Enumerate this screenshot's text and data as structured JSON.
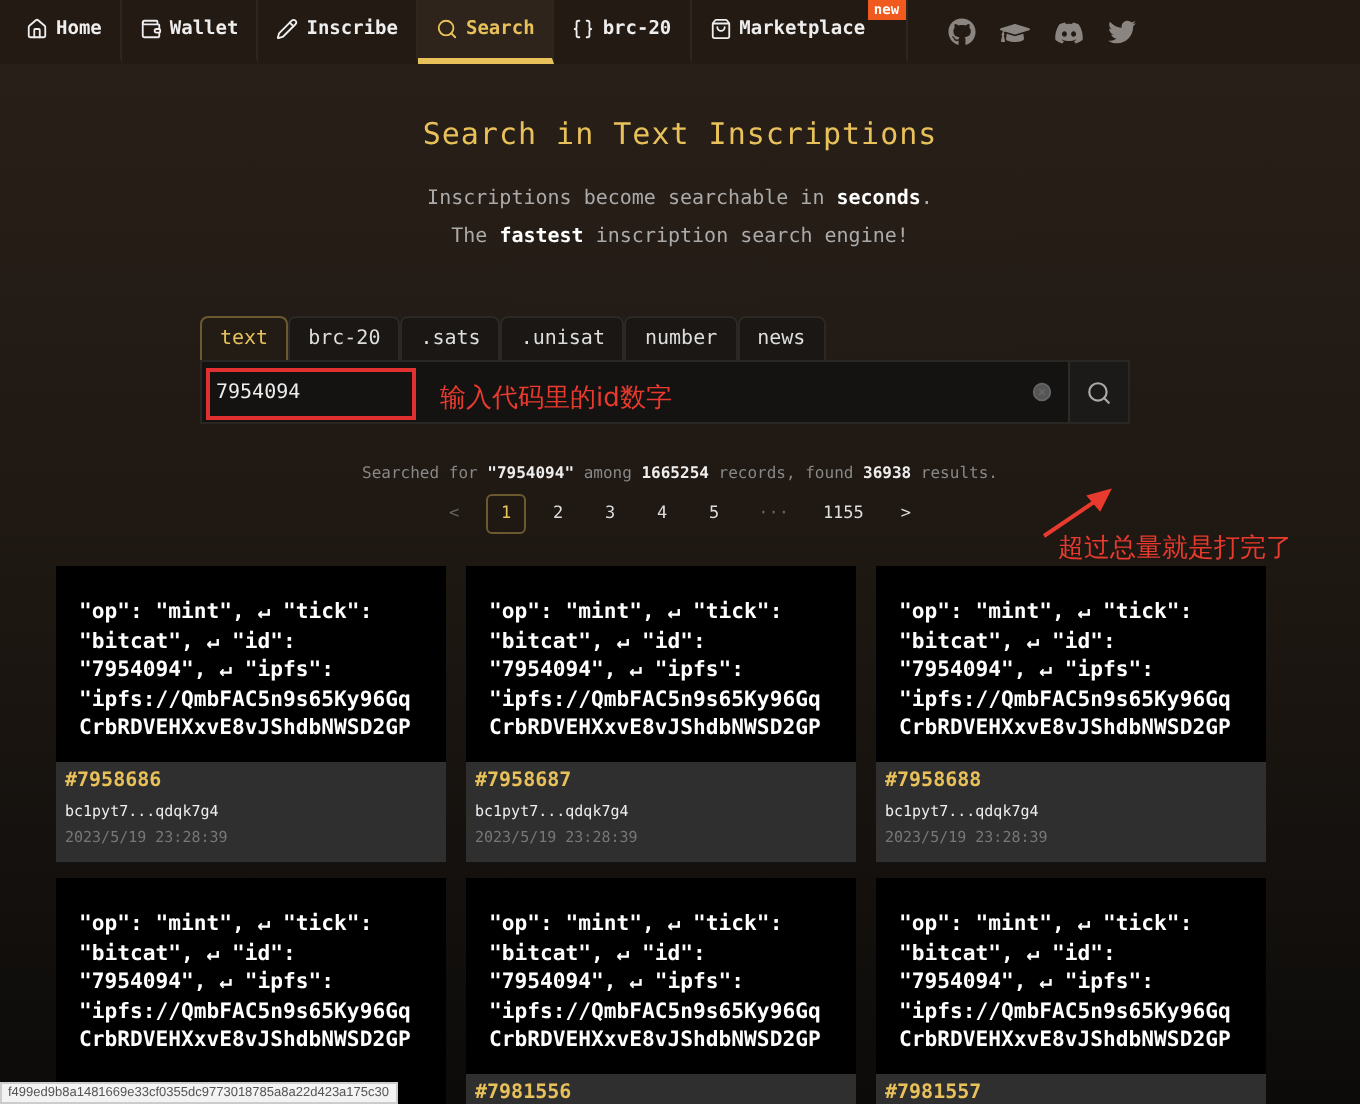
{
  "nav": {
    "items": [
      {
        "label": "Home",
        "selected": false
      },
      {
        "label": "Wallet",
        "selected": false
      },
      {
        "label": "Inscribe",
        "selected": false
      },
      {
        "label": "Search",
        "selected": true
      },
      {
        "label": "brc-20",
        "selected": false
      },
      {
        "label": "Marketplace",
        "selected": false,
        "badge": "new"
      }
    ]
  },
  "hero": {
    "title": "Search in Text Inscriptions",
    "lines": [
      "Inscriptions become searchable in **seconds**.",
      "The **fastest** inscription search engine!"
    ]
  },
  "search_tabs": [
    {
      "label": "text",
      "selected": true
    },
    {
      "label": "brc-20",
      "selected": false
    },
    {
      "label": ".sats",
      "selected": false
    },
    {
      "label": ".unisat",
      "selected": false
    },
    {
      "label": "number",
      "selected": false
    },
    {
      "label": "news",
      "selected": false
    }
  ],
  "search": {
    "value": "7954094"
  },
  "annotations": {
    "input_note": "输入代码里的id数字",
    "total_note": "超过总量就是打完了"
  },
  "summary": "Searched for **\"7954094\"** among **1665254** records, found **36938** results.",
  "pagination": [
    {
      "kind": "prev",
      "label": "<"
    },
    {
      "kind": "page",
      "label": "1",
      "selected": true
    },
    {
      "kind": "page",
      "label": "2",
      "selected": false
    },
    {
      "kind": "page",
      "label": "3",
      "selected": false
    },
    {
      "kind": "page",
      "label": "4",
      "selected": false
    },
    {
      "kind": "page",
      "label": "5",
      "selected": false
    },
    {
      "kind": "ellipsis",
      "label": "···"
    },
    {
      "kind": "page",
      "label": "1155",
      "selected": false
    },
    {
      "kind": "next",
      "label": ">"
    }
  ],
  "cards": [
    {
      "content": "\"op\": \"mint\", ↵ \"tick\": \"bitcat\", ↵ \"id\": \"7954094\", ↵ \"ipfs\": \"ipfs://QmbFAC5n9s65Ky96GqCrbRDVEHXxvE8vJShdbNWSD2GP",
      "number": "#7958686",
      "address": "bc1pyt7...qdqk7g4",
      "time": "2023/5/19 23:28:39"
    },
    {
      "content": "\"op\": \"mint\", ↵ \"tick\": \"bitcat\", ↵ \"id\": \"7954094\", ↵ \"ipfs\": \"ipfs://QmbFAC5n9s65Ky96GqCrbRDVEHXxvE8vJShdbNWSD2GP",
      "number": "#7958687",
      "address": "bc1pyt7...qdqk7g4",
      "time": "2023/5/19 23:28:39"
    },
    {
      "content": "\"op\": \"mint\", ↵ \"tick\": \"bitcat\", ↵ \"id\": \"7954094\", ↵ \"ipfs\": \"ipfs://QmbFAC5n9s65Ky96GqCrbRDVEHXxvE8vJShdbNWSD2GP",
      "number": "#7958688",
      "address": "bc1pyt7...qdqk7g4",
      "time": "2023/5/19 23:28:39"
    },
    {
      "content": "\"op\": \"mint\", ↵ \"tick\": \"bitcat\", ↵ \"id\": \"7954094\", ↵ \"ipfs\": \"ipfs://QmbFAC5n9s65Ky96GqCrbRDVEHXxvE8vJShdbNWSD2GP"
    },
    {
      "content": "\"op\": \"mint\", ↵ \"tick\": \"bitcat\", ↵ \"id\": \"7954094\", ↵ \"ipfs\": \"ipfs://QmbFAC5n9s65Ky96GqCrbRDVEHXxvE8vJShdbNWSD2GP",
      "number": "#7981556"
    },
    {
      "content": "\"op\": \"mint\", ↵ \"tick\": \"bitcat\", ↵ \"id\": \"7954094\", ↵ \"ipfs\": \"ipfs://QmbFAC5n9s65Ky96GqCrbRDVEHXxvE8vJShdbNWSD2GP",
      "number": "#7981557"
    }
  ],
  "status_url": "f499ed9b8a1481669e33cf0355dc9773018785a8a22d423a175c30"
}
